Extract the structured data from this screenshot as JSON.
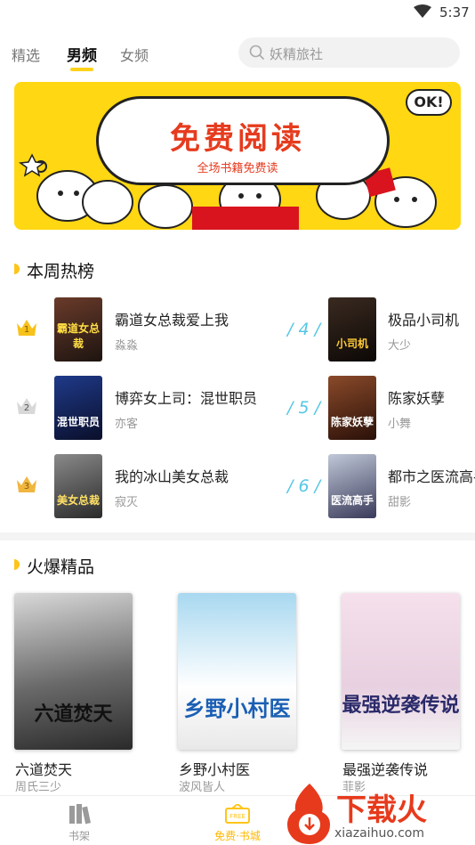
{
  "status_bar": {
    "time": "5:37"
  },
  "top_nav": {
    "tabs": [
      {
        "label": "精选"
      },
      {
        "label": "男频"
      },
      {
        "label": "女频"
      }
    ],
    "active_tab": "男频",
    "search": {
      "placeholder": "妖精旅社"
    }
  },
  "banner": {
    "title": "免费阅读",
    "subtitle": "全场书籍免费读",
    "ok_text": "OK!"
  },
  "hot_weekly": {
    "title": "本周热榜",
    "left": [
      {
        "rank": "1",
        "title": "霸道女总裁爱上我",
        "author": "淼淼",
        "cover_text": "霸道女总裁"
      },
      {
        "rank": "2",
        "title": "博弈女上司：混世职员",
        "author": "亦客",
        "cover_text": "混世职员"
      },
      {
        "rank": "3",
        "title": "我的冰山美女总裁",
        "author": "寂灭",
        "cover_text": "美女总裁"
      }
    ],
    "right": [
      {
        "rank": "/ 4 /",
        "title": "极品小司机",
        "author": "大少",
        "cover_text": "小司机"
      },
      {
        "rank": "/ 5 /",
        "title": "陈家妖孽",
        "author": "小舞",
        "cover_text": "陈家妖孽"
      },
      {
        "rank": "/ 6 /",
        "title": "都市之医流高手",
        "author": "甜影",
        "cover_text": "医流高手"
      }
    ]
  },
  "featured": {
    "title": "火爆精品",
    "books": [
      {
        "title": "六道焚天",
        "author": "周氏三少",
        "cover_text": "六道焚天"
      },
      {
        "title": "乡野小村医",
        "author": "波风皆人",
        "cover_text": "乡野小村医"
      },
      {
        "title": "最强逆袭传说",
        "author": "菲影",
        "cover_text": "最强逆袭传说"
      }
    ]
  },
  "bottom_nav": {
    "items": [
      {
        "label": "书架"
      },
      {
        "label": "免费·书城"
      }
    ]
  },
  "watermark": {
    "text": "下载火",
    "url": "xiazaihuo.com"
  },
  "colors": {
    "accent": "#ffd21a",
    "rank_blue": "#55c7e6",
    "brand_red": "#e73a1c"
  }
}
